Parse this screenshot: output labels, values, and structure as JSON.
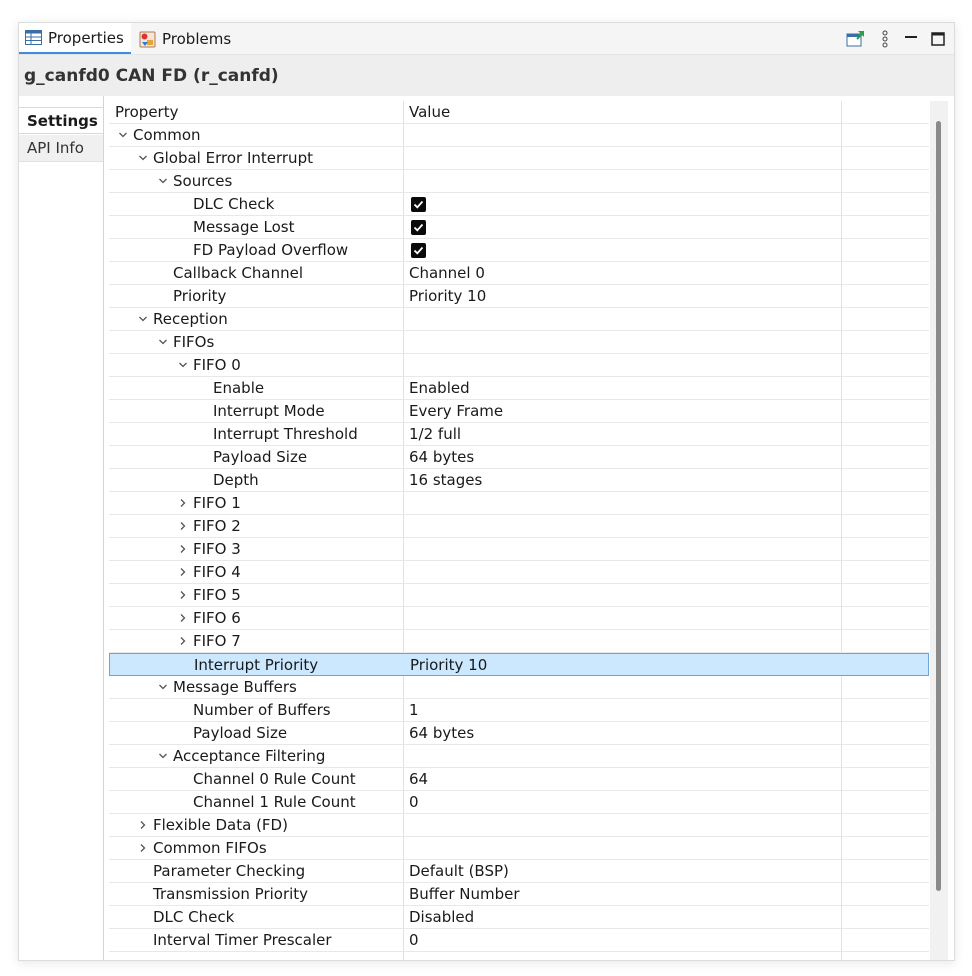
{
  "tabs": [
    {
      "label": "Properties",
      "icon": "table-icon",
      "active": true
    },
    {
      "label": "Problems",
      "icon": "problems-icon",
      "active": false
    }
  ],
  "toolbar": [
    "pin-icon",
    "more-icon",
    "minimize-icon",
    "maximize-icon"
  ],
  "header": {
    "title": "g_canfd0 CAN FD (r_canfd)"
  },
  "sidetabs": {
    "settings": "Settings",
    "api": "API Info"
  },
  "columns": {
    "property": "Property",
    "value": "Value"
  },
  "rows": [
    {
      "level": 0,
      "expander": "open",
      "label": "Common",
      "value": ""
    },
    {
      "level": 1,
      "expander": "open",
      "label": "Global Error Interrupt",
      "value": ""
    },
    {
      "level": 2,
      "expander": "open",
      "label": "Sources",
      "value": ""
    },
    {
      "level": 3,
      "expander": "none",
      "label": "DLC Check",
      "value": "",
      "checkbox": true
    },
    {
      "level": 3,
      "expander": "none",
      "label": "Message Lost",
      "value": "",
      "checkbox": true
    },
    {
      "level": 3,
      "expander": "none",
      "label": "FD Payload Overflow",
      "value": "",
      "checkbox": true
    },
    {
      "level": 2,
      "expander": "none",
      "label": "Callback Channel",
      "value": "Channel 0"
    },
    {
      "level": 2,
      "expander": "none",
      "label": "Priority",
      "value": "Priority 10"
    },
    {
      "level": 1,
      "expander": "open",
      "label": "Reception",
      "value": ""
    },
    {
      "level": 2,
      "expander": "open",
      "label": "FIFOs",
      "value": ""
    },
    {
      "level": 3,
      "expander": "open",
      "label": "FIFO 0",
      "value": ""
    },
    {
      "level": 4,
      "expander": "none",
      "label": "Enable",
      "value": "Enabled"
    },
    {
      "level": 4,
      "expander": "none",
      "label": "Interrupt Mode",
      "value": "Every Frame"
    },
    {
      "level": 4,
      "expander": "none",
      "label": "Interrupt Threshold",
      "value": "1/2 full"
    },
    {
      "level": 4,
      "expander": "none",
      "label": "Payload Size",
      "value": "64 bytes"
    },
    {
      "level": 4,
      "expander": "none",
      "label": "Depth",
      "value": "16 stages"
    },
    {
      "level": 3,
      "expander": "closed",
      "label": "FIFO 1",
      "value": ""
    },
    {
      "level": 3,
      "expander": "closed",
      "label": "FIFO 2",
      "value": ""
    },
    {
      "level": 3,
      "expander": "closed",
      "label": "FIFO 3",
      "value": ""
    },
    {
      "level": 3,
      "expander": "closed",
      "label": "FIFO 4",
      "value": ""
    },
    {
      "level": 3,
      "expander": "closed",
      "label": "FIFO 5",
      "value": ""
    },
    {
      "level": 3,
      "expander": "closed",
      "label": "FIFO 6",
      "value": ""
    },
    {
      "level": 3,
      "expander": "closed",
      "label": "FIFO 7",
      "value": ""
    },
    {
      "level": 3,
      "expander": "none",
      "label": "Interrupt Priority",
      "value": "Priority 10",
      "selected": true
    },
    {
      "level": 2,
      "expander": "open",
      "label": "Message Buffers",
      "value": ""
    },
    {
      "level": 3,
      "expander": "none",
      "label": "Number of Buffers",
      "value": "1"
    },
    {
      "level": 3,
      "expander": "none",
      "label": "Payload Size",
      "value": "64 bytes"
    },
    {
      "level": 2,
      "expander": "open",
      "label": "Acceptance Filtering",
      "value": ""
    },
    {
      "level": 3,
      "expander": "none",
      "label": "Channel 0 Rule Count",
      "value": "64"
    },
    {
      "level": 3,
      "expander": "none",
      "label": "Channel 1 Rule Count",
      "value": "0"
    },
    {
      "level": 1,
      "expander": "closed",
      "label": "Flexible Data (FD)",
      "value": ""
    },
    {
      "level": 1,
      "expander": "closed",
      "label": "Common FIFOs",
      "value": ""
    },
    {
      "level": 1,
      "expander": "none",
      "label": "Parameter Checking",
      "value": "Default (BSP)"
    },
    {
      "level": 1,
      "expander": "none",
      "label": "Transmission Priority",
      "value": "Buffer Number"
    },
    {
      "level": 1,
      "expander": "none",
      "label": "DLC Check",
      "value": "Disabled"
    },
    {
      "level": 1,
      "expander": "none",
      "label": "Interval Timer Prescaler",
      "value": "0"
    }
  ],
  "colors": {
    "selection": "#cce8ff",
    "selection_border": "#6aa6d9",
    "active_tab": "#3c8ce0"
  }
}
